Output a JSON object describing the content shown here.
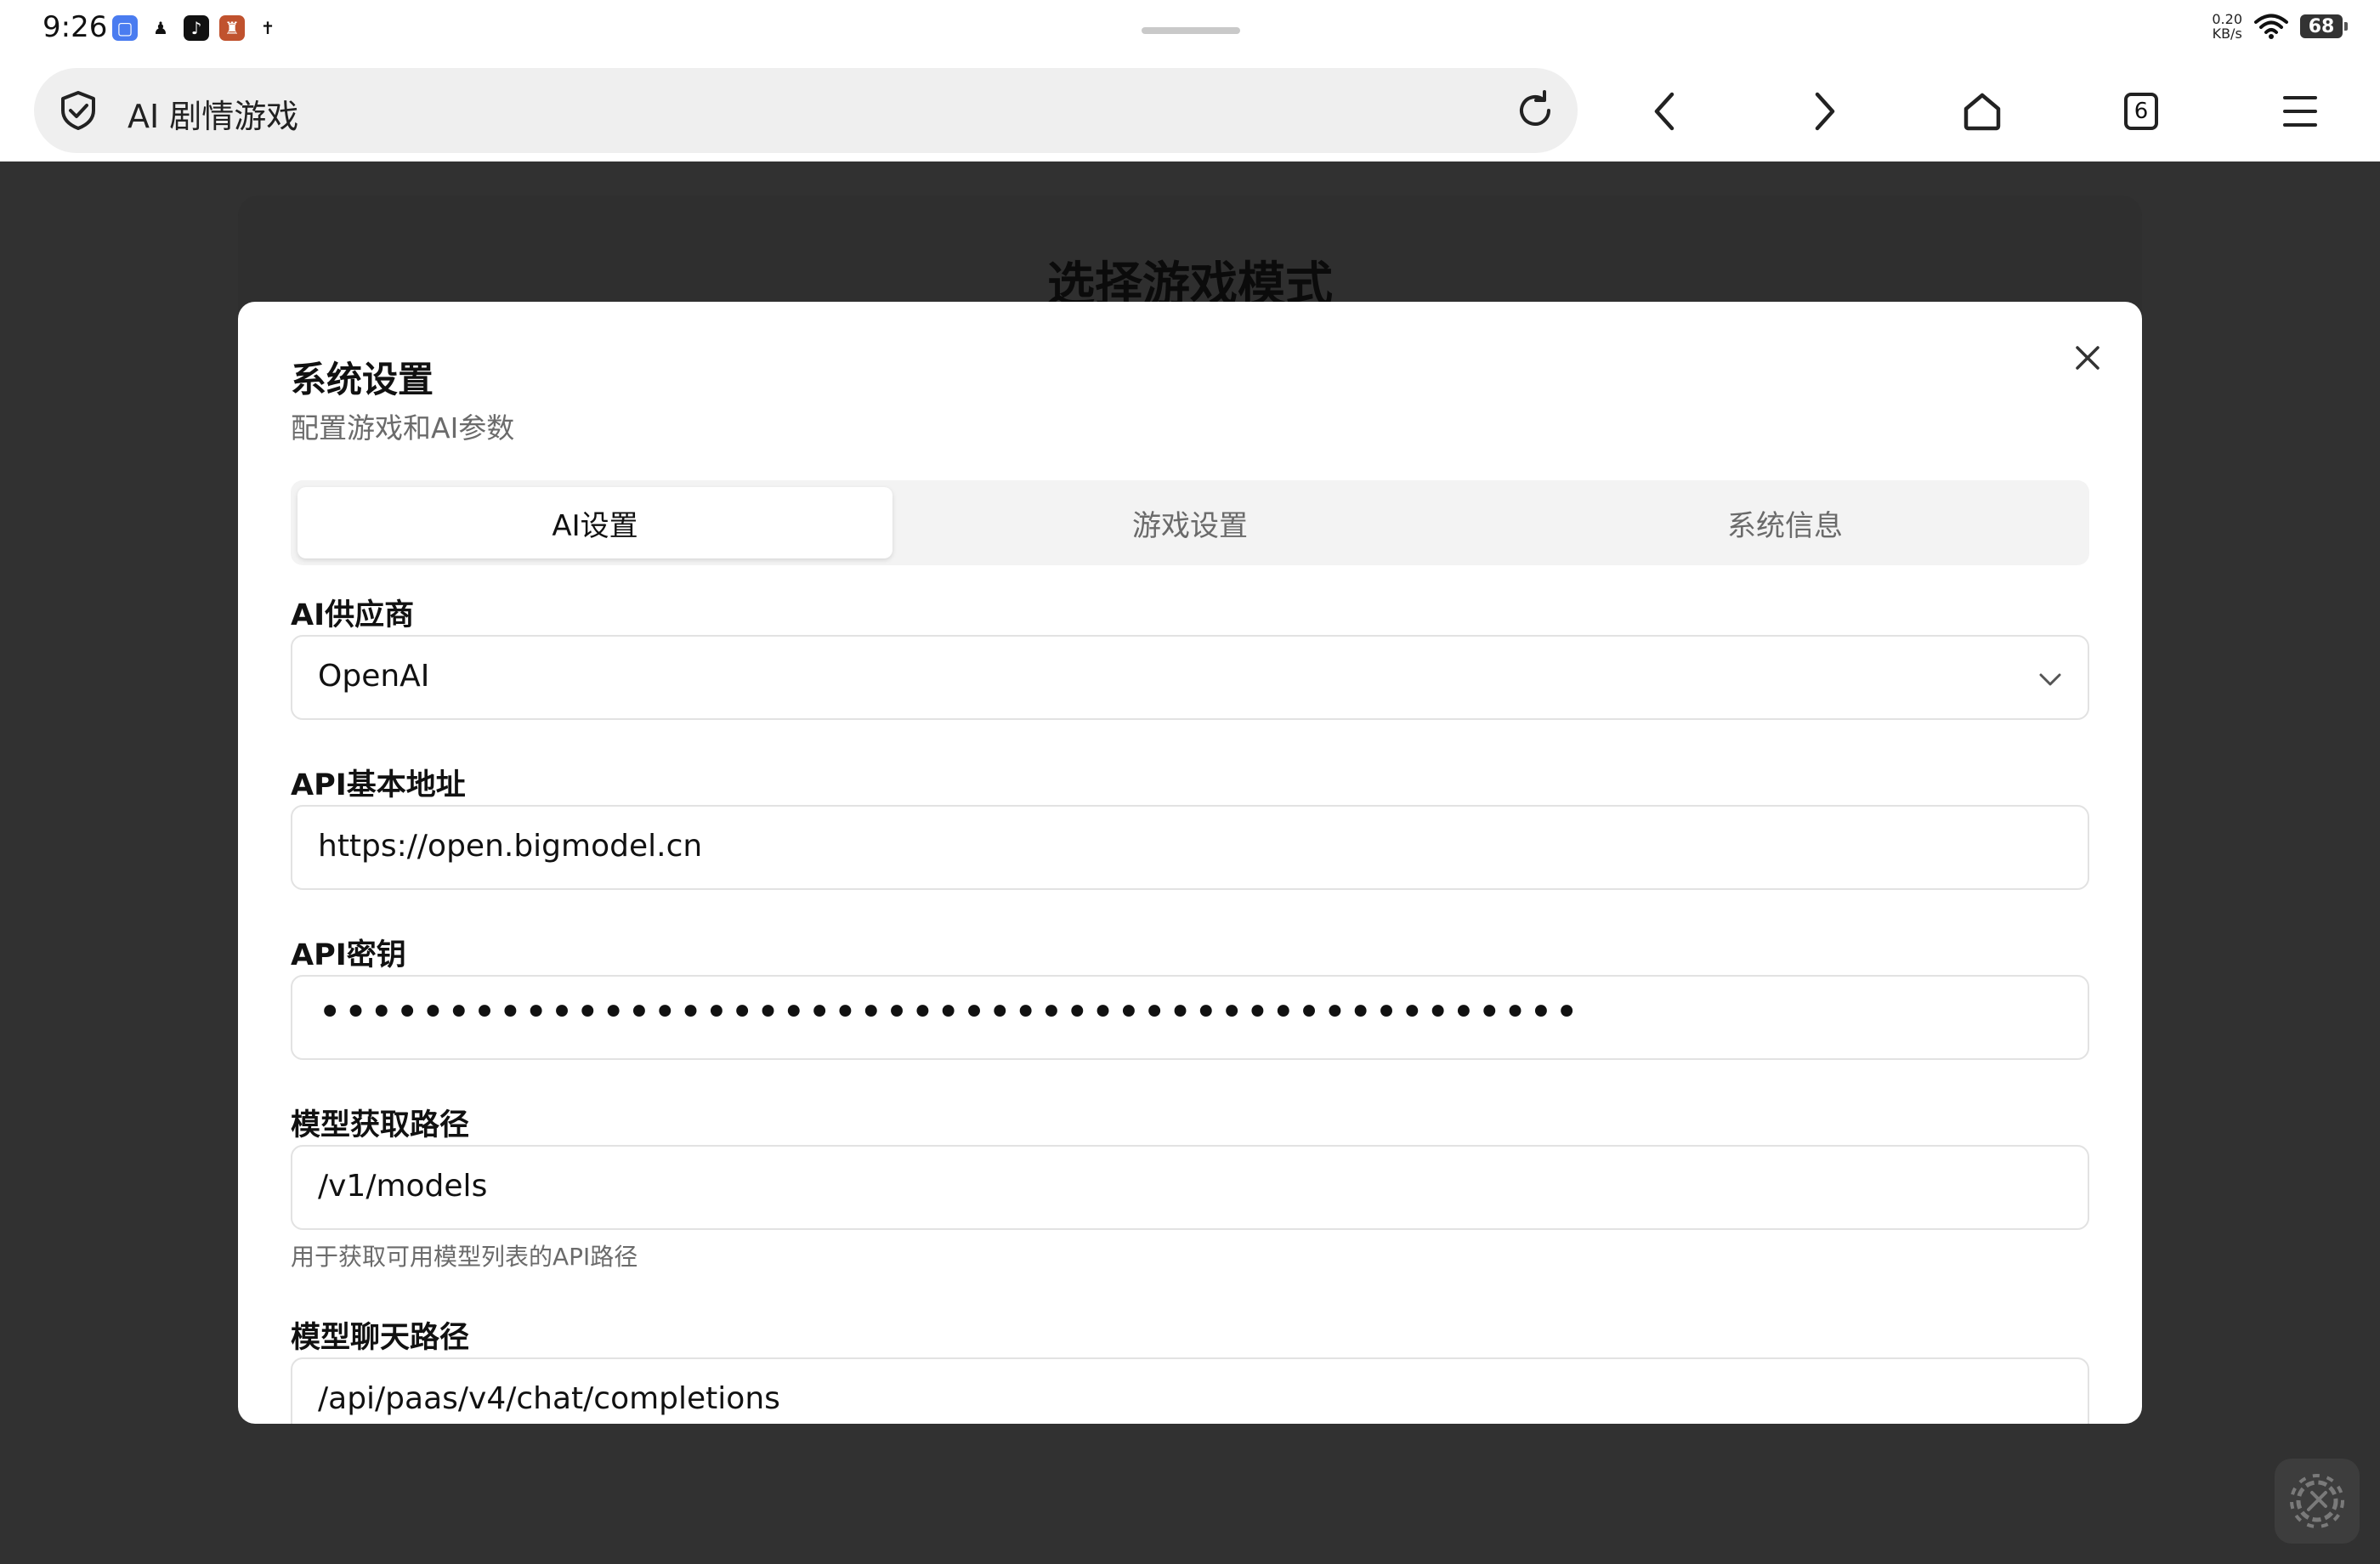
{
  "status_bar": {
    "time": "9:26",
    "net_speed_value": "0.20",
    "net_speed_unit": "KB/s",
    "battery": "68"
  },
  "browser": {
    "url_title": "AI 剧情游戏",
    "tab_count": "6"
  },
  "page": {
    "background_title": "选择游戏模式"
  },
  "modal": {
    "title": "系统设置",
    "subtitle": "配置游戏和AI参数",
    "tabs": [
      {
        "label": "AI设置",
        "active": true
      },
      {
        "label": "游戏设置",
        "active": false
      },
      {
        "label": "系统信息",
        "active": false
      }
    ],
    "fields": {
      "provider": {
        "label": "AI供应商",
        "value": "OpenAI"
      },
      "base_url": {
        "label": "API基本地址",
        "value": "https://open.bigmodel.cn"
      },
      "api_key": {
        "label": "API密钥",
        "value": "•••••••••••••••••••••••••••••••••••••••••••••••••"
      },
      "models_path": {
        "label": "模型获取路径",
        "value": "/v1/models",
        "hint": "用于获取可用模型列表的API路径"
      },
      "chat_path": {
        "label": "模型聊天路径",
        "value": "/api/paas/v4/chat/completions"
      }
    }
  },
  "colors": {
    "backdrop": "#313131",
    "modal_bg": "#ffffff",
    "tab_track": "#f3f3f3"
  }
}
